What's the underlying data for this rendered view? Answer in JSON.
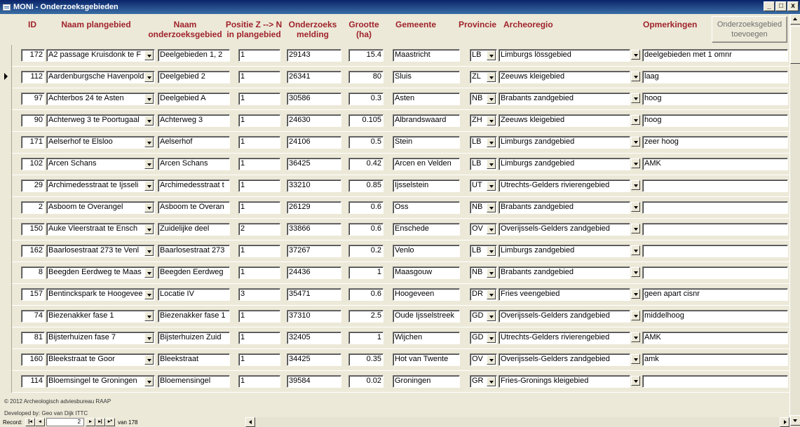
{
  "window": {
    "title": "MONI - Onderzoeksgebieden"
  },
  "header": {
    "id": "ID",
    "naam_plangebied": "Naam plangebied",
    "naam_onderzoeksgebied": "Naam onderzoeksgebied",
    "positie": "Positie Z --> N in plangebied",
    "onderzoeksmelding": "Onderzoeks melding",
    "grootte": "Grootte (ha)",
    "gemeente": "Gemeente",
    "provincie": "Provincie",
    "archeoregio": "Archeoregio",
    "opmerkingen": "Opmerkingen"
  },
  "add_button": "Onderzoeksgebied toevoegen",
  "rows": [
    {
      "id": "172",
      "plan": "A2 passage Kruisdonk te F",
      "onderzoek": "Deelgebieden 1, 2",
      "positie": "1",
      "melding": "29143",
      "grootte": "15.4",
      "gemeente": "Maastricht",
      "provincie": "LB",
      "archeoregio": "Limburgs lössgebied",
      "opmerkingen": "deelgebieden met 1 omnr"
    },
    {
      "id": "112",
      "plan": "Aardenburgsche Havenpold",
      "onderzoek": "Deelgebied 2",
      "positie": "1",
      "melding": "26341",
      "grootte": "80",
      "gemeente": "Sluis",
      "provincie": "ZL",
      "archeoregio": "Zeeuws kleigebied",
      "opmerkingen": "laag"
    },
    {
      "id": "97",
      "plan": "Achterbos 24 te Asten",
      "onderzoek": "Deelgebied A",
      "positie": "1",
      "melding": "30586",
      "grootte": "0.3",
      "gemeente": "Asten",
      "provincie": "NB",
      "archeoregio": "Brabants zandgebied",
      "opmerkingen": "hoog"
    },
    {
      "id": "90",
      "plan": "Achterweg 3 te Poortugaal",
      "onderzoek": "Achterweg 3",
      "positie": "1",
      "melding": "24630",
      "grootte": "0.105",
      "gemeente": "Albrandswaard",
      "provincie": "ZH",
      "archeoregio": "Zeeuws kleigebied",
      "opmerkingen": "hoog"
    },
    {
      "id": "171",
      "plan": "Aelserhof te Elsloo",
      "onderzoek": "Aelserhof",
      "positie": "1",
      "melding": "24106",
      "grootte": "0.5",
      "gemeente": "Stein",
      "provincie": "LB",
      "archeoregio": "Limburgs zandgebied",
      "opmerkingen": "zeer hoog"
    },
    {
      "id": "102",
      "plan": "Arcen Schans",
      "onderzoek": "Arcen Schans",
      "positie": "1",
      "melding": "36425",
      "grootte": "0.42",
      "gemeente": "Arcen en Velden",
      "provincie": "LB",
      "archeoregio": "Limburgs zandgebied",
      "opmerkingen": "AMK"
    },
    {
      "id": "29",
      "plan": "Archimedesstraat te Ijsseli",
      "onderzoek": "Archimedesstraat t",
      "positie": "1",
      "melding": "33210",
      "grootte": "0.85",
      "gemeente": "Ijsselstein",
      "provincie": "UT",
      "archeoregio": "Utrechts-Gelders rivierengebied",
      "opmerkingen": ""
    },
    {
      "id": "2",
      "plan": "Asboom te Overangel",
      "onderzoek": "Asboom te Overan",
      "positie": "1",
      "melding": "26129",
      "grootte": "0.6",
      "gemeente": "Oss",
      "provincie": "NB",
      "archeoregio": "Brabants zandgebied",
      "opmerkingen": ""
    },
    {
      "id": "150",
      "plan": "Auke Vleerstraat te Ensch",
      "onderzoek": "Zuidelijke deel",
      "positie": "2",
      "melding": "33866",
      "grootte": "0.6",
      "gemeente": "Enschede",
      "provincie": "OV",
      "archeoregio": "Overijssels-Gelders zandgebied",
      "opmerkingen": ""
    },
    {
      "id": "162",
      "plan": "Baarlosestraat 273 te Venl",
      "onderzoek": "Baarlosestraat 273",
      "positie": "1",
      "melding": "37267",
      "grootte": "0.2",
      "gemeente": "Venlo",
      "provincie": "LB",
      "archeoregio": "Limburgs zandgebied",
      "opmerkingen": ""
    },
    {
      "id": "8",
      "plan": "Beegden Eerdweg te Maas",
      "onderzoek": "Beegden Eerdweg",
      "positie": "1",
      "melding": "24436",
      "grootte": "1",
      "gemeente": "Maasgouw",
      "provincie": "NB",
      "archeoregio": "Brabants zandgebied",
      "opmerkingen": ""
    },
    {
      "id": "157",
      "plan": "Bentinckspark te Hoogevee",
      "onderzoek": "Locatie IV",
      "positie": "3",
      "melding": "35471",
      "grootte": "0.6",
      "gemeente": "Hoogeveen",
      "provincie": "DR",
      "archeoregio": "Fries veengebied",
      "opmerkingen": "geen apart cisnr"
    },
    {
      "id": "74",
      "plan": "Biezenakker fase 1",
      "onderzoek": "Biezenakker fase 1",
      "positie": "1",
      "melding": "37310",
      "grootte": "2.5",
      "gemeente": "Oude Ijsselstreek",
      "provincie": "GD",
      "archeoregio": "Overijssels-Gelders zandgebied",
      "opmerkingen": "middelhoog"
    },
    {
      "id": "81",
      "plan": "Bijsterhuizen fase 7",
      "onderzoek": "Bijsterhuizen Zuid",
      "positie": "1",
      "melding": "32405",
      "grootte": "1",
      "gemeente": "Wijchen",
      "provincie": "GD",
      "archeoregio": "Utrechts-Gelders rivierengebied",
      "opmerkingen": "AMK"
    },
    {
      "id": "160",
      "plan": "Bleekstraat te Goor",
      "onderzoek": "Bleekstraat",
      "positie": "1",
      "melding": "34425",
      "grootte": "0.35",
      "gemeente": "Hot van Twente",
      "provincie": "OV",
      "archeoregio": "Overijssels-Gelders zandgebied",
      "opmerkingen": "amk"
    },
    {
      "id": "114",
      "plan": "Bloemsingel te Groningen",
      "onderzoek": "Bloemensingel",
      "positie": "1",
      "melding": "39584",
      "grootte": "0.02",
      "gemeente": "Groningen",
      "provincie": "GR",
      "archeoregio": "Fries-Gronings kleigebied",
      "opmerkingen": ""
    }
  ],
  "footer": {
    "copyright": "© 2012 Archeologisch adviesbureau RAAP",
    "developer": "Developed by: Geo van Dijk ITTC",
    "record_label": "Record:",
    "record_current": "2",
    "record_of": "van 178"
  }
}
